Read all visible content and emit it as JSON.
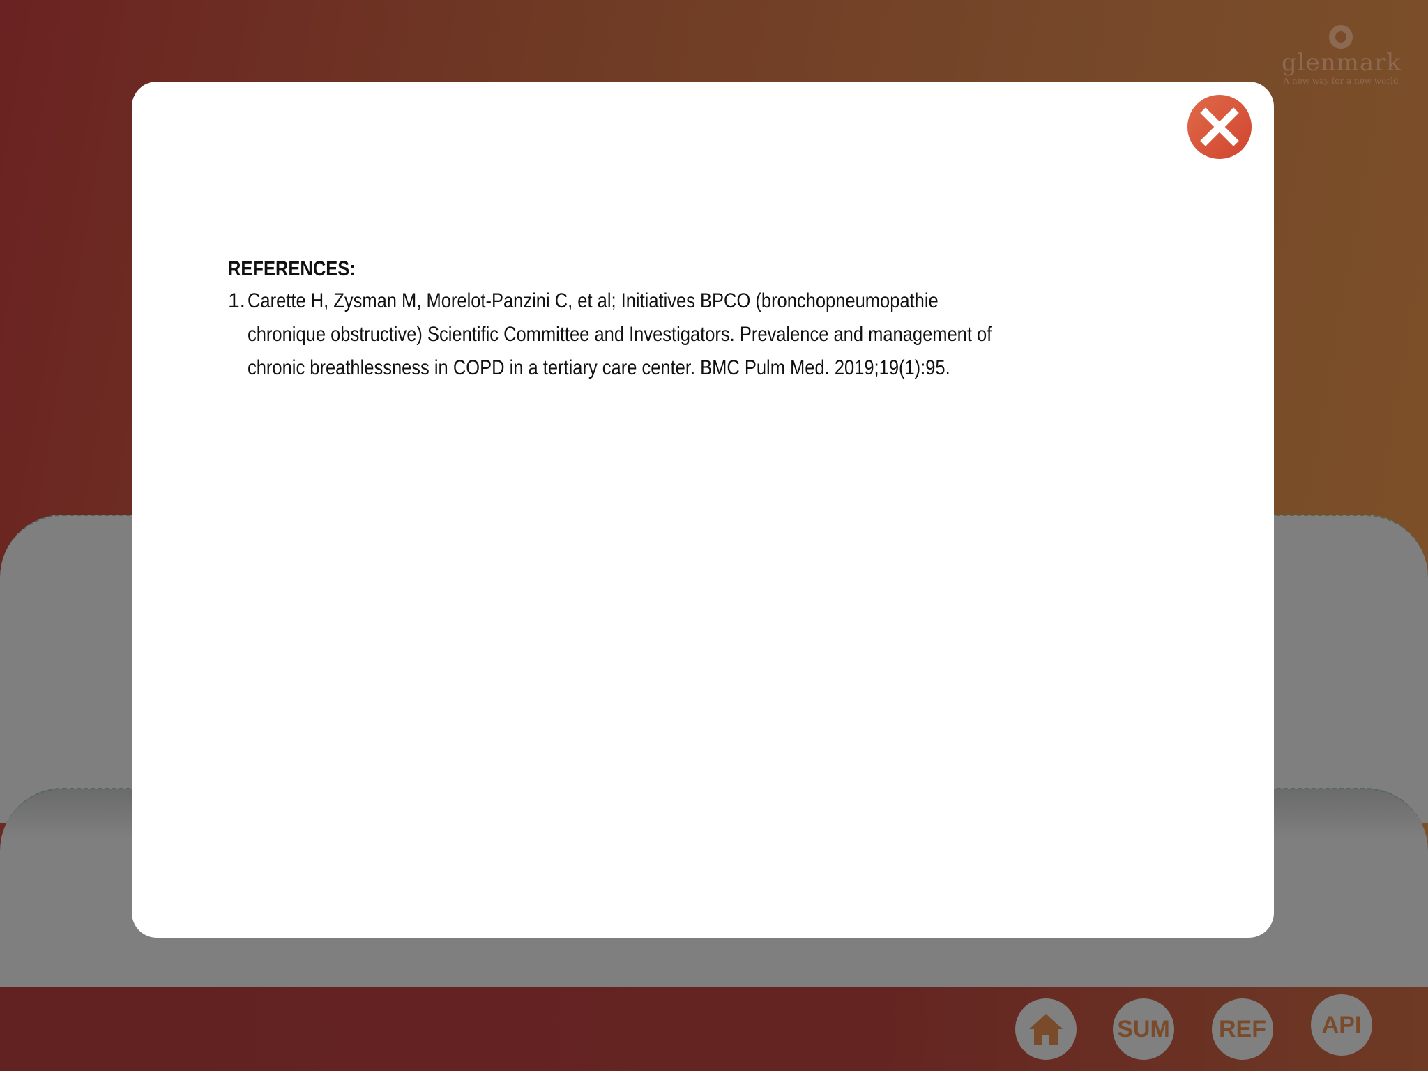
{
  "brand": {
    "name": "glenmark",
    "tagline": "A new way for a new world"
  },
  "modal": {
    "heading": "REFERENCES:",
    "references": [
      {
        "number": "1.",
        "text": "Carette H, Zysman M, Morelot-Panzini C, et al; Initiatives BPCO (bronchopneumopathie chronique obstructive) Scientific Committee and Investigators. Prevalence and management of chronic breathlessness in COPD in a tertiary care center. BMC Pulm Med. 2019;19(1):95."
      }
    ],
    "close_icon": "close-icon"
  },
  "nav": {
    "home_icon": "home-icon",
    "sum_label": "SUM",
    "ref_label": "REF",
    "api_label": "API"
  },
  "colors": {
    "close_button": "#d9563a",
    "nav_button": "#808080",
    "nav_label": "#7a4b2a",
    "overlay_gray": "#7f7f7f"
  }
}
